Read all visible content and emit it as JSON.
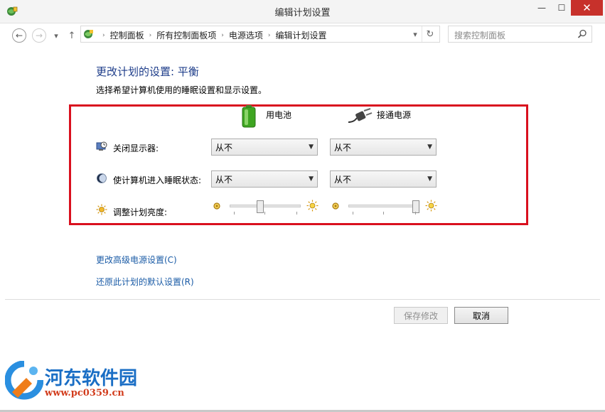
{
  "window": {
    "title": "编辑计划设置",
    "minimize": "—",
    "maximize": "☐",
    "close": "✕"
  },
  "nav": {
    "back": "←",
    "forward": "→",
    "history": "▾",
    "up": "↑"
  },
  "address": {
    "crumbs": [
      "控制面板",
      "所有控制面板项",
      "电源选项",
      "编辑计划设置"
    ],
    "separator": "›",
    "dropdown": "▾",
    "refresh": "↻"
  },
  "search": {
    "placeholder": "搜索控制面板",
    "icon": "search-icon"
  },
  "main": {
    "heading": "更改计划的设置: 平衡",
    "subtext": "选择希望计算机使用的睡眠设置和显示设置。",
    "columns": {
      "battery": "用电池",
      "plugged": "接通电源"
    },
    "rows": {
      "display": {
        "label": "关闭显示器:",
        "battery_value": "从不",
        "plugged_value": "从不"
      },
      "sleep": {
        "label": "使计算机进入睡眠状态:",
        "battery_value": "从不",
        "plugged_value": "从不"
      },
      "brightness": {
        "label": "调整计划亮度:",
        "battery_level": 0.42,
        "plugged_level": 1.0
      }
    },
    "links": {
      "advanced": "更改高级电源设置(C)",
      "restore": "还原此计划的默认设置(R)"
    },
    "buttons": {
      "save": "保存修改",
      "cancel": "取消"
    }
  },
  "watermark": {
    "name": "河东软件园",
    "url": "www.pc0359.cn"
  },
  "colors": {
    "heading": "#1e3d8a",
    "link": "#1a5ba6",
    "highlight_box": "#d9101e",
    "close": "#c7312b"
  }
}
